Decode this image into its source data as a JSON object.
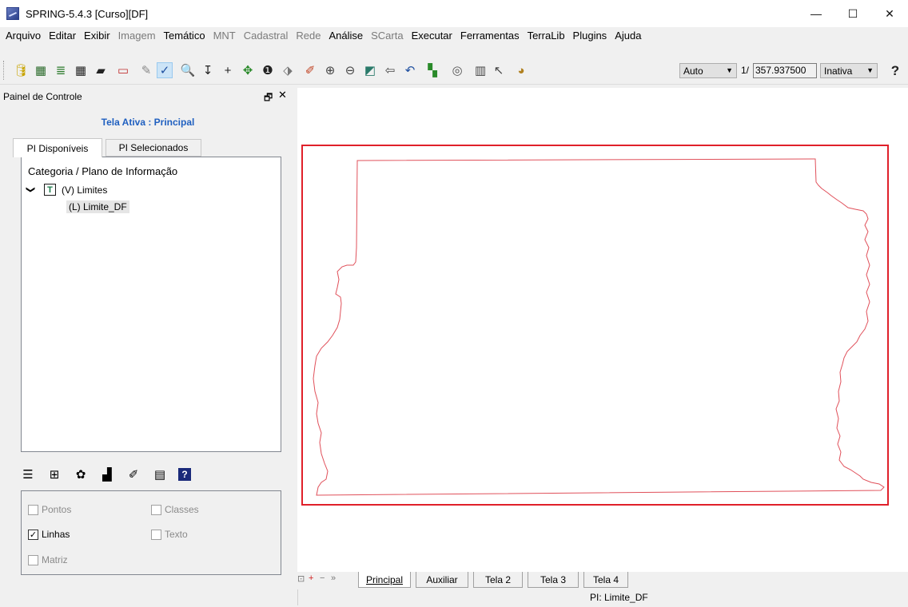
{
  "window": {
    "title": "SPRING-5.4.3 [Curso][DF]",
    "minimize_glyph": "—",
    "maximize_glyph": "☐",
    "close_glyph": "✕"
  },
  "menu": {
    "items": [
      {
        "label": "Arquivo",
        "enabled": true
      },
      {
        "label": "Editar",
        "enabled": true
      },
      {
        "label": "Exibir",
        "enabled": true
      },
      {
        "label": "Imagem",
        "enabled": false
      },
      {
        "label": "Temático",
        "enabled": true
      },
      {
        "label": "MNT",
        "enabled": false
      },
      {
        "label": "Cadastral",
        "enabled": false
      },
      {
        "label": "Rede",
        "enabled": false
      },
      {
        "label": "Análise",
        "enabled": true
      },
      {
        "label": "SCarta",
        "enabled": false
      },
      {
        "label": "Executar",
        "enabled": true
      },
      {
        "label": "Ferramentas",
        "enabled": true
      },
      {
        "label": "TerraLib",
        "enabled": true
      },
      {
        "label": "Plugins",
        "enabled": true
      },
      {
        "label": "Ajuda",
        "enabled": true
      }
    ]
  },
  "toolbar": {
    "icons": [
      {
        "name": "database-icon",
        "glyph": "🛢",
        "color": "#c8a400"
      },
      {
        "name": "project-icon",
        "glyph": "▦",
        "color": "#2a6a2a"
      },
      {
        "name": "layers-icon",
        "glyph": "≣",
        "color": "#2a7a2a"
      },
      {
        "name": "grid-icon",
        "glyph": "▦",
        "color": "#222222"
      },
      {
        "name": "polygon-icon",
        "glyph": "▰",
        "color": "#222222"
      },
      {
        "name": "window-icon",
        "glyph": "▭",
        "color": "#c03030"
      },
      {
        "name": "cursor-tool-icon",
        "glyph": "✎",
        "color": "#888888"
      },
      {
        "name": "draw-mode-icon",
        "glyph": "✓",
        "color": "#2050a0"
      },
      {
        "name": "zoom-search-icon",
        "glyph": "🔍",
        "color": "#555555"
      },
      {
        "name": "pan-down-icon",
        "glyph": "↧",
        "color": "#222222"
      },
      {
        "name": "crosshair-icon",
        "glyph": "+",
        "color": "#222222"
      },
      {
        "name": "move-icon",
        "glyph": "✥",
        "color": "#2a8a2a"
      },
      {
        "name": "info-icon",
        "glyph": "❶",
        "color": "#222222"
      },
      {
        "name": "tag-icon",
        "glyph": "⬗",
        "color": "#777777"
      },
      {
        "name": "edit-pencil-icon",
        "glyph": "✐",
        "color": "#c04020"
      },
      {
        "name": "zoom-in-icon",
        "glyph": "⊕",
        "color": "#444444"
      },
      {
        "name": "zoom-out-icon",
        "glyph": "⊖",
        "color": "#444444"
      },
      {
        "name": "zoom-area-icon",
        "glyph": "◩",
        "color": "#2a7a6a"
      },
      {
        "name": "back-arrow-icon",
        "glyph": "⇦",
        "color": "#444444"
      },
      {
        "name": "undo-icon",
        "glyph": "↶",
        "color": "#2050a0"
      },
      {
        "name": "color-table-icon",
        "glyph": "▚",
        "color": "#2a8a2a"
      },
      {
        "name": "zoom-options-icon",
        "glyph": "◎",
        "color": "#555555"
      },
      {
        "name": "legend-icon",
        "glyph": "▥",
        "color": "#444444"
      },
      {
        "name": "pointer-plus-icon",
        "glyph": "↖",
        "color": "#444444"
      },
      {
        "name": "palette-icon",
        "glyph": "◕",
        "color": "#b08020"
      }
    ],
    "scale_mode": "Auto",
    "scale_prefix": "1/",
    "scale_value": "357.937500",
    "status_combo": "Inativa",
    "help_glyph": "?"
  },
  "panel": {
    "title": "Painel de Controle",
    "float_glyph": "🗗",
    "close_glyph": "✕",
    "active_screen": "Tela Ativa : Principal",
    "tabs": {
      "available": "PI Disponíveis",
      "selected": "PI Selecionados"
    },
    "tree": {
      "header": "Categoria / Plano de Informação",
      "expand_glyph": "❯",
      "category_type": "T",
      "category": "(V) Limites",
      "plan": "(L) Limite_DF"
    },
    "tools": [
      {
        "name": "list-icon",
        "glyph": "☰"
      },
      {
        "name": "table-zoom-icon",
        "glyph": "⊞"
      },
      {
        "name": "style-icon",
        "glyph": "✿"
      },
      {
        "name": "chart-icon",
        "glyph": "▟"
      },
      {
        "name": "visual-edit-icon",
        "glyph": "✐"
      },
      {
        "name": "properties-icon",
        "glyph": "▤"
      },
      {
        "name": "help-icon",
        "glyph": "?"
      }
    ],
    "options": {
      "points": "Pontos",
      "classes": "Classes",
      "lines": "Linhas",
      "text": "Texto",
      "matrix": "Matriz",
      "check_glyph": "✓"
    }
  },
  "bottom": {
    "controls": [
      "⊡",
      "+",
      "−",
      "»"
    ],
    "tabs": [
      "Principal",
      "Auxiliar",
      "Tela 2",
      "Tela 3",
      "Tela 4"
    ],
    "status": "PI: Limite_DF"
  },
  "colors": {
    "map_frame": "#e0202a",
    "boundary_line": "#e0505a"
  }
}
